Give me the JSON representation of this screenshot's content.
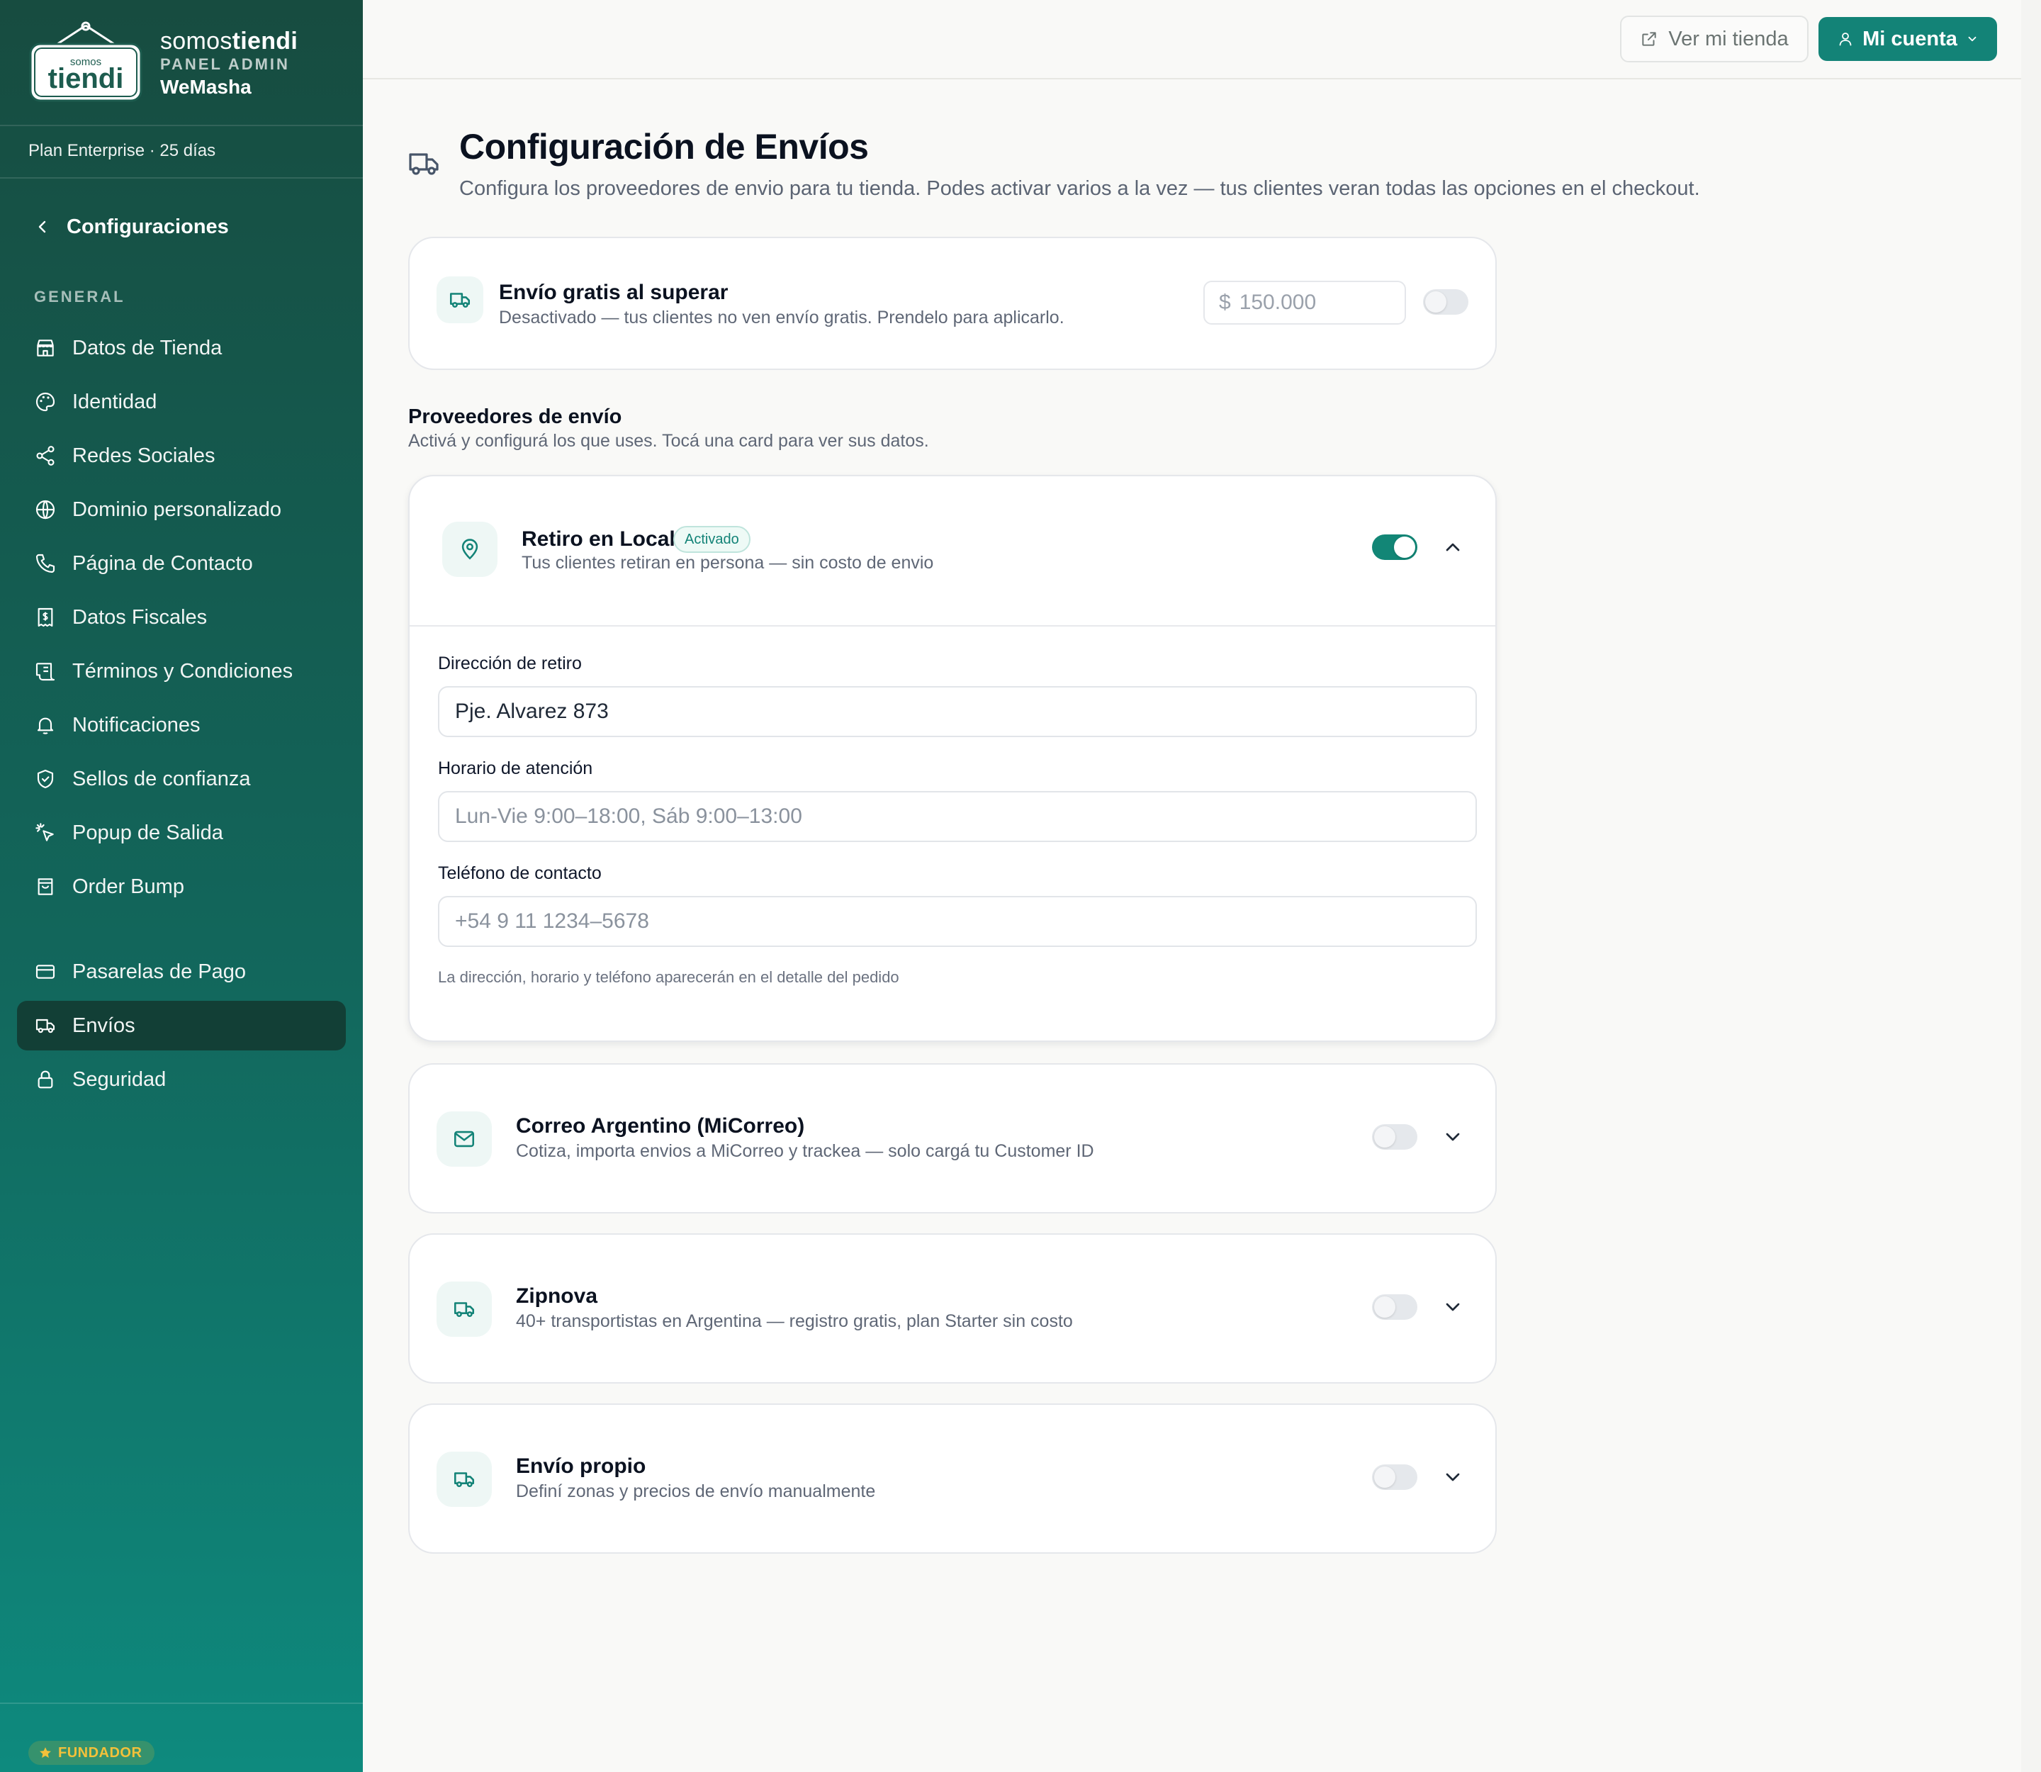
{
  "colors": {
    "accent": "#138377",
    "sidebar_top": "#174c40",
    "sidebar_bottom": "#0e8a7e",
    "active_item": "#123f36",
    "badge_gold": "#f3c13a"
  },
  "brand": {
    "logo_small": "somos",
    "logo_big": "tiendi",
    "name_light": "somos",
    "name_bold": "tiendi",
    "panel": "PANEL ADMIN",
    "store": "WeMasha"
  },
  "plan": "Plan Enterprise · 25 días",
  "back": {
    "label": "Configuraciones",
    "icon": "chevron-left-icon"
  },
  "nav": {
    "section_label": "GENERAL",
    "items": [
      {
        "label": "Datos de Tienda",
        "icon": "store-icon"
      },
      {
        "label": "Identidad",
        "icon": "palette-icon"
      },
      {
        "label": "Redes Sociales",
        "icon": "share-icon"
      },
      {
        "label": "Dominio personalizado",
        "icon": "globe-icon"
      },
      {
        "label": "Página de Contacto",
        "icon": "phone-icon"
      },
      {
        "label": "Datos Fiscales",
        "icon": "receipt-icon"
      },
      {
        "label": "Términos y Condiciones",
        "icon": "scroll-icon"
      },
      {
        "label": "Notificaciones",
        "icon": "bell-icon"
      },
      {
        "label": "Sellos de confianza",
        "icon": "shield-check-icon"
      },
      {
        "label": "Popup de Salida",
        "icon": "pointer-click-icon"
      },
      {
        "label": "Order Bump",
        "icon": "shopping-bag-icon"
      },
      {
        "label": "Pasarelas de Pago",
        "icon": "credit-card-icon"
      },
      {
        "label": "Envíos",
        "icon": "truck-icon",
        "active": true
      },
      {
        "label": "Seguridad",
        "icon": "lock-icon"
      }
    ]
  },
  "footer_badge": {
    "label": "FUNDADOR",
    "icon": "star-icon"
  },
  "topbar": {
    "view_store": {
      "label": "Ver mi tienda",
      "icon": "external-link-icon"
    },
    "account": {
      "label": "Mi cuenta",
      "icon": "user-icon",
      "chevron": "chevron-down-icon"
    }
  },
  "page": {
    "title": "Configuración de Envíos",
    "subtitle": "Configura los proveedores de envio para tu tienda. Podes activar varios a la vez — tus clientes veran todas las opciones en el checkout.",
    "icon": "truck-icon"
  },
  "free_shipping": {
    "title": "Envío gratis al superar",
    "desc": "Desactivado — tus clientes no ven envío gratis. Prendelo para aplicarlo.",
    "currency": "$",
    "amount_placeholder": "150.000",
    "enabled": false
  },
  "providers_section": {
    "title": "Proveedores de envío",
    "desc": "Activá y configurá los que uses. Tocá una card para ver sus datos."
  },
  "pickup": {
    "title": "Retiro en Local",
    "badge": "Activado",
    "desc": "Tus clientes retiran en persona — sin costo de envio",
    "enabled": true,
    "expanded": true,
    "fields": {
      "address_label": "Dirección de retiro",
      "address_value": "Pje. Alvarez 873",
      "hours_label": "Horario de atención",
      "hours_placeholder": "Lun-Vie 9:00–18:00, Sáb 9:00–13:00",
      "phone_label": "Teléfono de contacto",
      "phone_placeholder": "+54 9 11 1234–5678"
    },
    "help": "La dirección, horario y teléfono aparecerán en el detalle del pedido"
  },
  "providers": [
    {
      "title": "Correo Argentino (MiCorreo)",
      "desc": "Cotiza, importa envios a MiCorreo y trackea — solo cargá tu Customer ID",
      "icon": "mail-icon",
      "enabled": false
    },
    {
      "title": "Zipnova",
      "desc": "40+ transportistas en Argentina — registro gratis, plan Starter sin costo",
      "icon": "truck-icon",
      "enabled": false
    },
    {
      "title": "Envío propio",
      "desc": "Definí zonas y precios de envío manualmente",
      "icon": "truck-icon",
      "enabled": false
    }
  ]
}
